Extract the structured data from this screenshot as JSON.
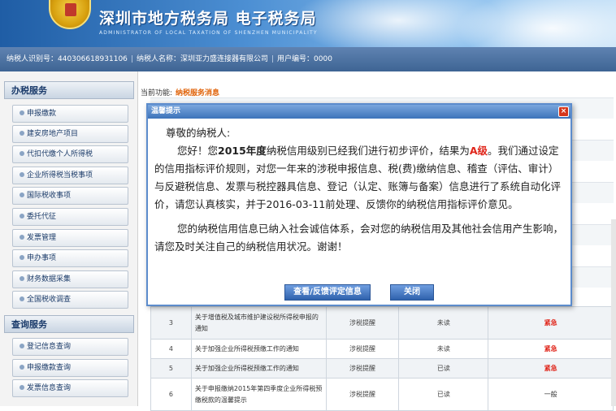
{
  "header": {
    "title": "深圳市地方税务局 电子税务局",
    "subtitle": "ADMINISTRATOR OF LOCAL TAXATION OF SHENZHEN MUNICIPALITY"
  },
  "infobar": {
    "taxpayer_id": "纳税人识别号：440306618931106",
    "taxpayer_name": "纳税人名称：深圳亚力盛连接器有限公司",
    "user_no": "用户编号：0000"
  },
  "sidebar": {
    "section1": "办税服务",
    "items1": [
      "申报缴款",
      "建安房地产项目",
      "代扣代缴个人所得税",
      "企业所得税当税事项",
      "国际税收事项",
      "委托代征",
      "发票管理",
      "申办事项",
      "财务数据采集",
      "全国税收调查"
    ],
    "section2": "查询服务",
    "items2": [
      "登记信息查询",
      "申报缴款查询",
      "发票信息查询"
    ]
  },
  "main": {
    "crumb_label": "当前功能:",
    "crumb_current": "纳税服务消息"
  },
  "messages": [
    {
      "num": "3",
      "title": "关于增值税及城市维护建设税所得税申报的通知",
      "type": "涉税提醒",
      "status": "未读",
      "level": "紧急",
      "urgent": true
    },
    {
      "num": "4",
      "title": "关于加强企业所得税预缴工作的通知",
      "type": "涉税提醒",
      "status": "未读",
      "level": "紧急",
      "urgent": true
    },
    {
      "num": "5",
      "title": "关于加强企业所得税预缴工作的通知",
      "type": "涉税提醒",
      "status": "已读",
      "level": "紧急",
      "urgent": true
    },
    {
      "num": "6",
      "title": "关于申报缴纳2015年第四季度企业所得税预缴税款的温馨提示",
      "type": "涉税提醒",
      "status": "已读",
      "level": "一般",
      "urgent": false
    }
  ],
  "modal": {
    "title": "温馨提示",
    "greeting": "尊敬的纳税人:",
    "para1_a": "您好！您",
    "para1_year": "2015年度",
    "para1_b": "纳税信用级别已经我们进行初步评价，结果为",
    "para1_grade": "A级",
    "para1_c": "。我们通过设定的信用指标评价规则，对您一年来的涉税申报信息、税(费)缴纳信息、稽查（评估、审计）与反避税信息、发票与税控器具信息、登记（认定、账簿与备案）信息进行了系统自动化评价，请您认真核实，并于2016-03-11前处理、反馈你的纳税信用指标评价意见。",
    "para2": "您的纳税信用信息已纳入社会诚信体系，会对您的纳税信用及其他社会信用产生影响，请您及时关注自己的纳税信用状况。谢谢！",
    "btn_view": "查看/反馈评定信息",
    "btn_close": "关闭"
  },
  "colors": {
    "accent_orange": "#e0630a",
    "urgent_red": "#e0261b",
    "header_blue": "#1f5da5"
  }
}
